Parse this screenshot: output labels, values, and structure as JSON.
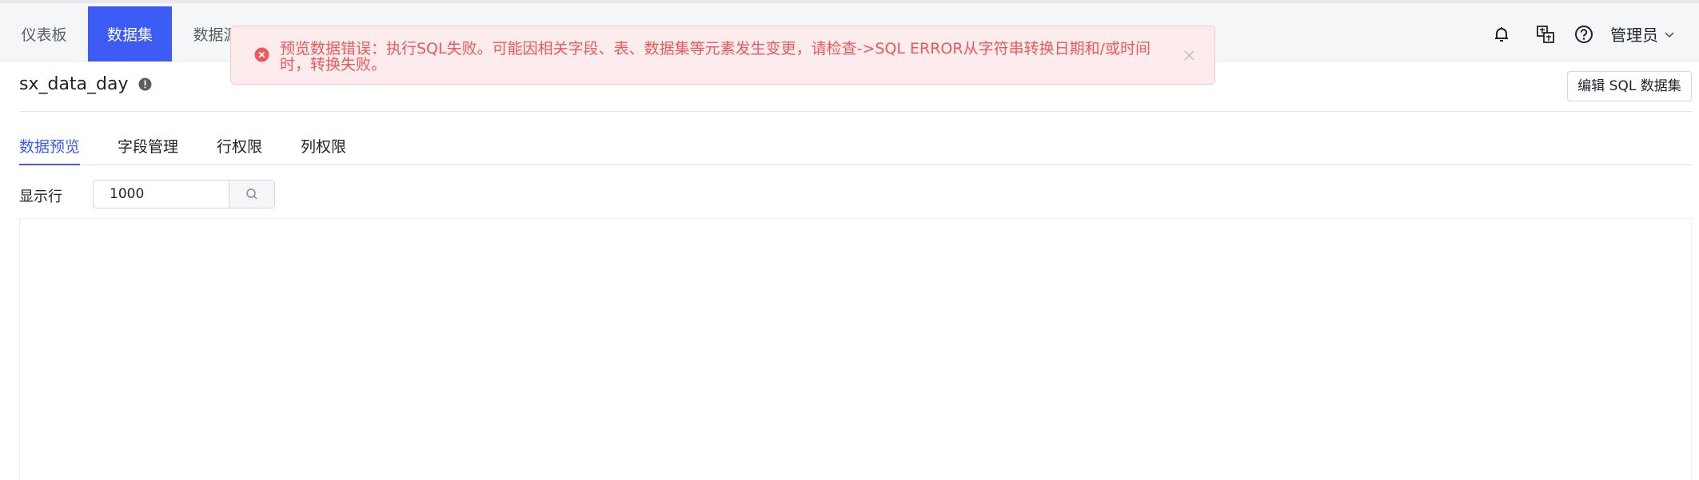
{
  "nav": {
    "tabs": [
      {
        "label": "仪表板"
      },
      {
        "label": "数据集"
      },
      {
        "label": "数据源"
      }
    ],
    "user": {
      "name": "管理员"
    },
    "icons": [
      "bell-icon",
      "translate-icon",
      "help-icon",
      "chevron-down-icon"
    ]
  },
  "alert": {
    "message": "预览数据错误：执行SQL失败。可能因相关字段、表、数据集等元素发生变更，请检查->SQL ERROR从字符串转换日期和/或时间时，转换失败。",
    "type": "error",
    "color": "#ea5a5a"
  },
  "dataset": {
    "name": "sx_data_day",
    "edit_button": "编辑 SQL 数据集"
  },
  "sub_tabs": [
    {
      "label": "数据预览"
    },
    {
      "label": "字段管理"
    },
    {
      "label": "行权限"
    },
    {
      "label": "列权限"
    }
  ],
  "rows": {
    "label": "显示行",
    "value": "1000"
  },
  "theme": {
    "accent": "#3d5cf5"
  }
}
